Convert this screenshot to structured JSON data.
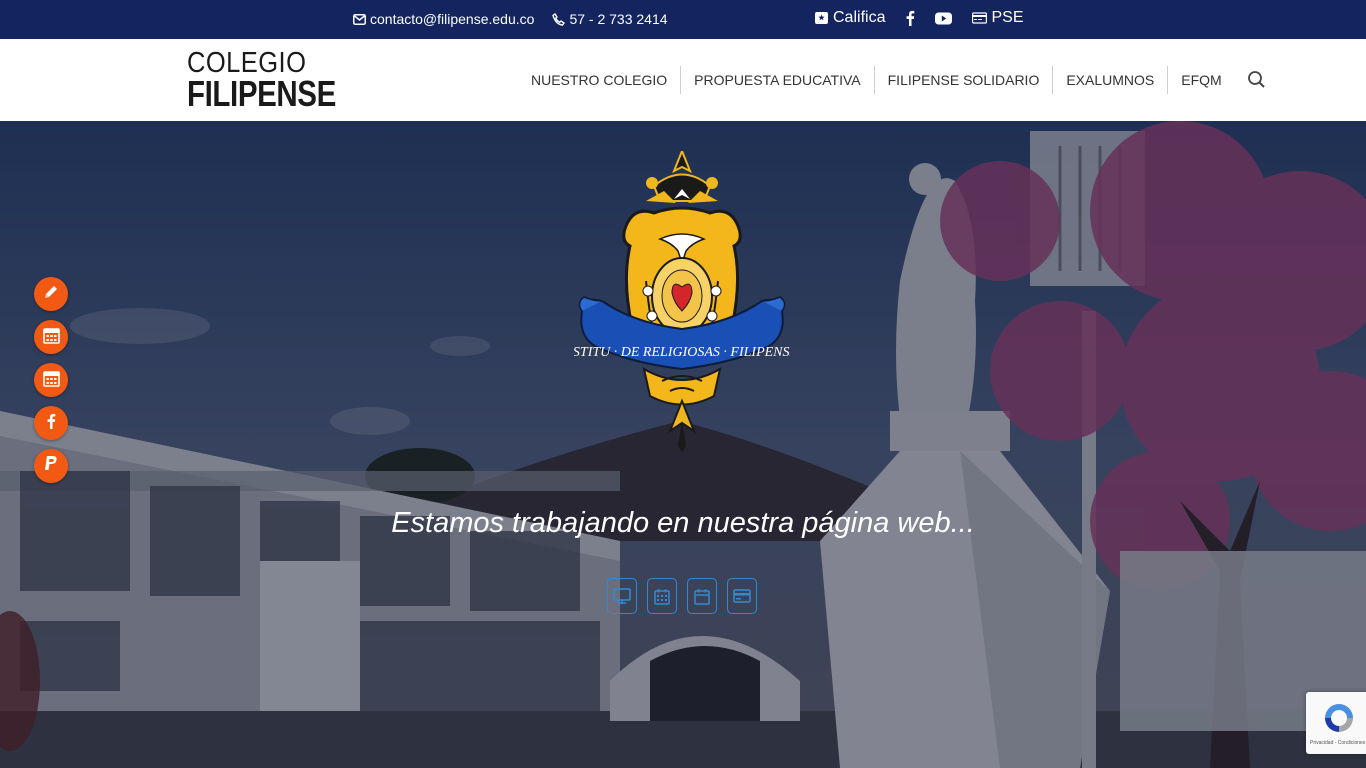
{
  "topbar": {
    "email": "contacto@filipense.edu.co",
    "phone": "57 - 2 733 2414",
    "califica_label": "Califica",
    "pse_label": "PSE"
  },
  "header": {
    "logo_line1": "COLEGIO",
    "logo_line2": "FILIPENSE",
    "nav": [
      {
        "label": "NUESTRO COLEGIO"
      },
      {
        "label": "PROPUESTA EDUCATIVA"
      },
      {
        "label": "FILIPENSE SOLIDARIO"
      },
      {
        "label": "EXALUMNOS"
      },
      {
        "label": "EFQM"
      }
    ]
  },
  "hero": {
    "headline": "Estamos trabajando en nuestra página web...",
    "crest_motto": "INSTITU DE RELIGIOSAS FILIPENSES",
    "quick_icons": [
      "monitor-icon",
      "calendar-grid-icon",
      "calendar-icon",
      "card-icon"
    ]
  },
  "floatbar": {
    "buttons": [
      "pencil-icon",
      "calendar-icon",
      "calendar-icon",
      "facebook-icon",
      "paypal-icon"
    ]
  },
  "recaptcha": {
    "text": "Privacidad - Condiciones"
  },
  "colors": {
    "topbar": "#13245e",
    "accent_orange": "#f25a14",
    "icon_blue": "#2f8bd6"
  }
}
